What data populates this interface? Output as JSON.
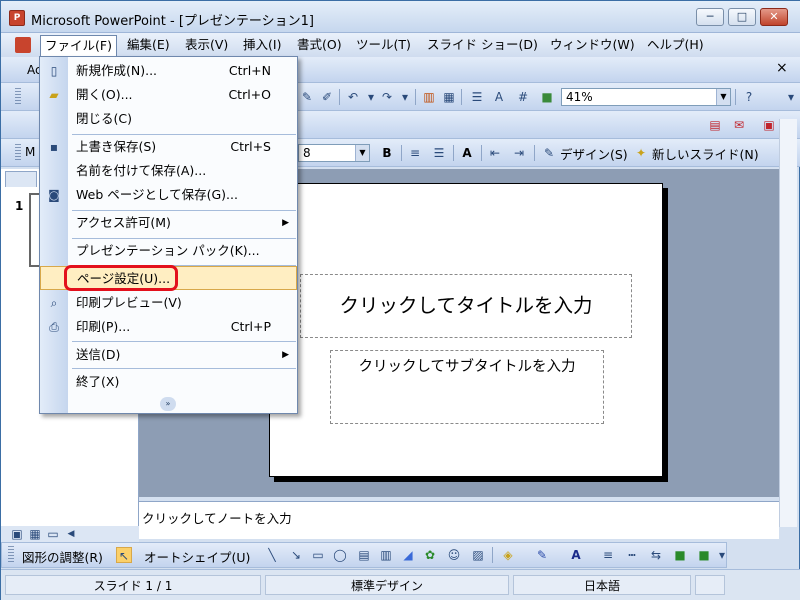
{
  "window": {
    "title": "Microsoft PowerPoint - [プレゼンテーション1]",
    "minimize_glyph": "─",
    "maximize_glyph": "□",
    "close_glyph": "✕",
    "app_icon_text": "P"
  },
  "menubar": {
    "items": [
      "ファイル(F)",
      "編集(E)",
      "表示(V)",
      "挿入(I)",
      "書式(O)",
      "ツール(T)",
      "スライド ショー(D)",
      "ウィンドウ(W)",
      "ヘルプ(H)"
    ],
    "doc_close": "×"
  },
  "toolbar": {
    "zoom": "41%",
    "font_size": "8",
    "design_label": "デザイン(S)",
    "new_slide_label": "新しいスライド(N)",
    "bold_label": "B",
    "tab_label": "M",
    "hidden_toolbar_text": "Ac"
  },
  "file_menu": {
    "items": [
      {
        "label": "新規作成(N)...",
        "shortcut": "Ctrl+N",
        "icon": "new-document-icon"
      },
      {
        "label": "開く(O)...",
        "shortcut": "Ctrl+O",
        "icon": "open-folder-icon"
      },
      {
        "label": "閉じる(C)",
        "shortcut": "",
        "icon": ""
      },
      {
        "label": "上書き保存(S)",
        "shortcut": "Ctrl+S",
        "icon": "save-icon"
      },
      {
        "label": "名前を付けて保存(A)...",
        "shortcut": "",
        "icon": ""
      },
      {
        "label": "Web ページとして保存(G)...",
        "shortcut": "",
        "icon": "web-save-icon"
      },
      {
        "label": "アクセス許可(M)",
        "shortcut": "",
        "icon": "",
        "submenu": true
      },
      {
        "label": "プレゼンテーション パック(K)...",
        "shortcut": "",
        "icon": ""
      },
      {
        "label": "ページ設定(U)...",
        "shortcut": "",
        "icon": ""
      },
      {
        "label": "印刷プレビュー(V)",
        "shortcut": "",
        "icon": "print-preview-icon"
      },
      {
        "label": "印刷(P)...",
        "shortcut": "Ctrl+P",
        "icon": "print-icon"
      },
      {
        "label": "送信(D)",
        "shortcut": "",
        "icon": "",
        "submenu": true
      },
      {
        "label": "終了(X)",
        "shortcut": "",
        "icon": ""
      }
    ],
    "expand_glyph": "»"
  },
  "slide": {
    "title_placeholder": "クリックしてタイトルを入力",
    "subtitle_placeholder": "クリックしてサブタイトルを入力"
  },
  "left_pane": {
    "slide_number": "1"
  },
  "notes": {
    "placeholder": "クリックしてノートを入力"
  },
  "draw_toolbar": {
    "adjust_label": "図形の調整(R)",
    "autoshape_label": "オートシェイプ(U)"
  },
  "statusbar": {
    "slide": "スライド 1 / 1",
    "design": "標準デザイン",
    "language": "日本語"
  },
  "colors": {
    "highlight_ring": "#e3101c",
    "menu_hover": "#ffeec2",
    "workspace": "#8d9db4"
  }
}
